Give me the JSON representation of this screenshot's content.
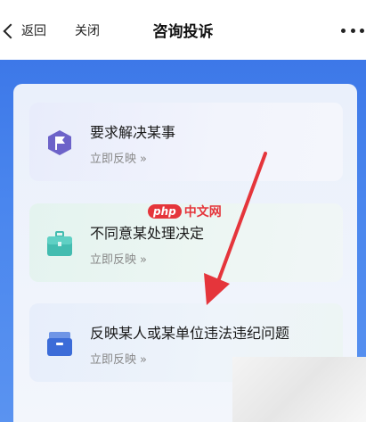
{
  "nav": {
    "back_label": "返回",
    "close_label": "关闭",
    "title": "咨询投诉"
  },
  "cards": [
    {
      "title": "要求解决某事",
      "action": "立即反映",
      "icon": "flag-icon"
    },
    {
      "title": "不同意某处理决定",
      "action": "立即反映",
      "icon": "briefcase-icon"
    },
    {
      "title": "反映某人或某单位违法违纪问题",
      "action": "立即反映",
      "icon": "inbox-icon"
    }
  ],
  "action_arrow": "»",
  "watermark": {
    "badge": "php",
    "text": "中文网"
  },
  "colors": {
    "header_blue": "#3d78e8",
    "flag_purple": "#6d63c9",
    "briefcase_teal": "#43bcb0",
    "inbox_blue": "#3c6cd8",
    "annotation_red": "#e5353b"
  }
}
